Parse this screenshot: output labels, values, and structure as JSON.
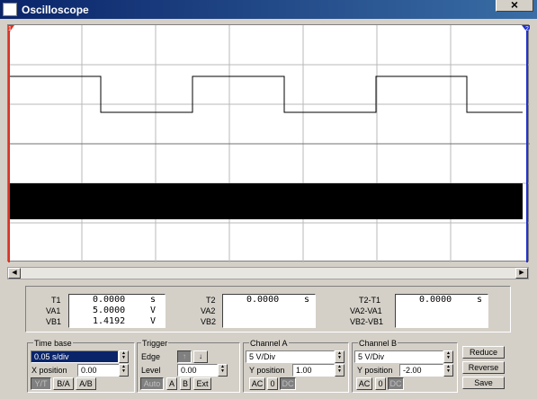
{
  "window": {
    "title": "Oscilloscope",
    "close_glyph": "×"
  },
  "cursors": {
    "t1_label": "1",
    "t2_label": "2",
    "t1_color": "#e03020",
    "t2_color": "#2030d0"
  },
  "readout": {
    "t1": {
      "label": "T1",
      "value": "0.0000",
      "unit": "s"
    },
    "va1": {
      "label": "VA1",
      "value": "5.0000",
      "unit": "V"
    },
    "vb1": {
      "label": "VB1",
      "value": "1.4192",
      "unit": "V"
    },
    "t2": {
      "label": "T2",
      "value": "0.0000",
      "unit": "s"
    },
    "va2": {
      "label": "VA2"
    },
    "vb2": {
      "label": "VB2"
    },
    "t2t1": {
      "label": "T2-T1",
      "value": "0.0000",
      "unit": "s"
    },
    "va2va1": {
      "label": "VA2-VA1"
    },
    "vb2vb1": {
      "label": "VB2-VB1"
    }
  },
  "time_base": {
    "title": "Time base",
    "scale": "0.05 s/div",
    "x_position_label": "X position",
    "x_position": "0.00",
    "modes": [
      "Y/T",
      "B/A",
      "A/B"
    ]
  },
  "trigger": {
    "title": "Trigger",
    "edge_label": "Edge",
    "level_label": "Level",
    "level": "0.00",
    "sources": [
      "Auto",
      "A",
      "B",
      "Ext"
    ]
  },
  "channel_a": {
    "title": "Channel A",
    "scale": "5 V/Div",
    "y_position_label": "Y position",
    "y_position": "1.00",
    "coupling": [
      "AC",
      "0",
      "DC"
    ]
  },
  "channel_b": {
    "title": "Channel B",
    "scale": "5 V/Div",
    "y_position_label": "Y position",
    "y_position": "-2.00",
    "coupling": [
      "AC",
      "0",
      "DC"
    ]
  },
  "actions": {
    "reduce": "Reduce",
    "reverse": "Reverse",
    "save": "Save"
  },
  "icons": {
    "rising_edge": "rising-edge-icon",
    "falling_edge": "falling-edge-icon"
  }
}
